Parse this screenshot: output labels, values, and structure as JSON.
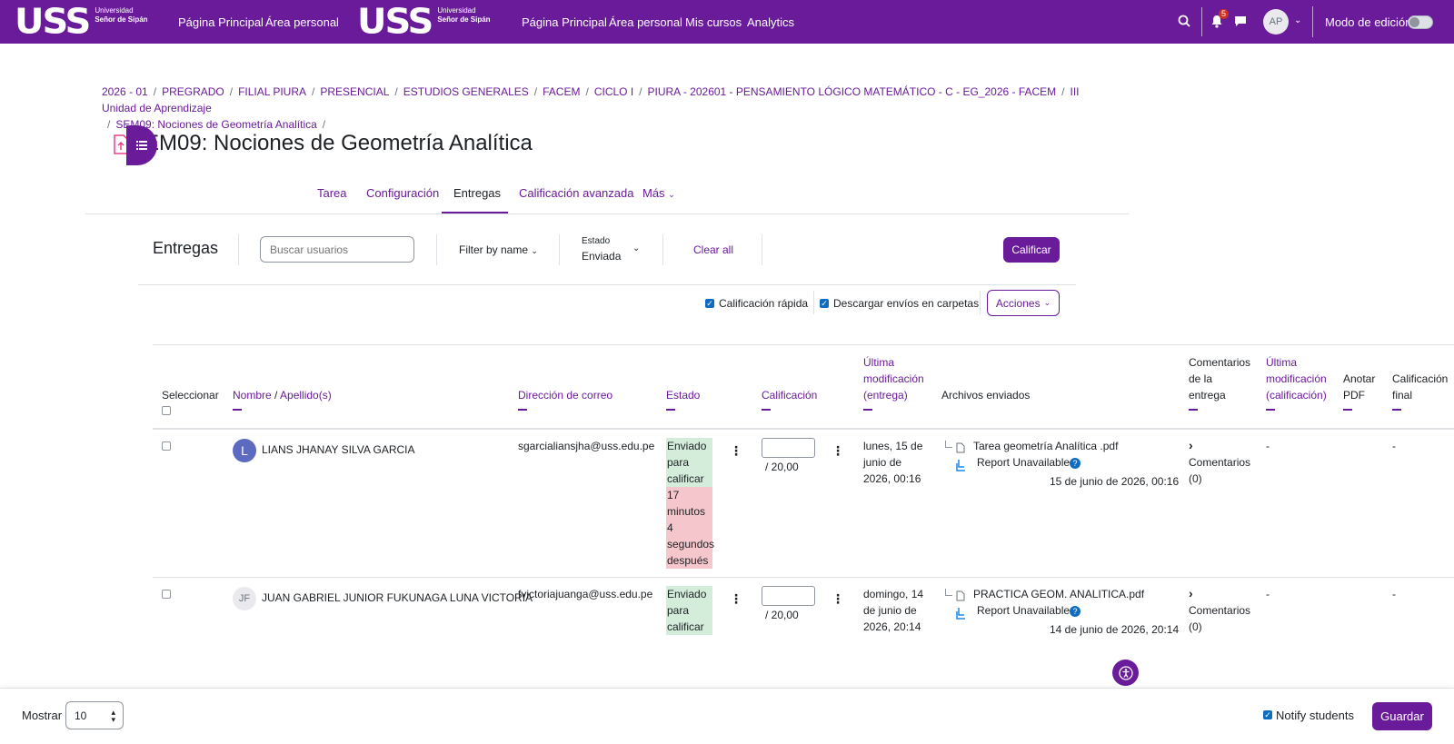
{
  "navbar": {
    "logo_text": "USS",
    "logo_sub1": "Universidad",
    "logo_sub2": "Señor de Sipán",
    "links_left": [
      "Página Principal",
      "Área personal"
    ],
    "links_right": [
      "Página Principal",
      "Área personal",
      "Mis cursos",
      "Analytics"
    ],
    "notifications_count": "5",
    "avatar_initials": "AP",
    "edit_mode_label": "Modo de edición"
  },
  "breadcrumb": [
    "2026 - 01",
    "PREGRADO",
    "FILIAL PIURA",
    "PRESENCIAL",
    "ESTUDIOS GENERALES",
    "FACEM",
    "CICLO I",
    "PIURA - 202601 - PENSAMIENTO LÓGICO MATEMÁTICO - C - EG_2026 - FACEM",
    "III Unidad de Aprendizaje",
    "SEM09: Nociones de Geometría Analítica"
  ],
  "page_title": "SEM09: Nociones de Geometría Analítica",
  "tabs": [
    "Tarea",
    "Configuración",
    "Entregas",
    "Calificación avanzada",
    "Más"
  ],
  "filters": {
    "heading": "Entregas",
    "search_placeholder": "Buscar usuarios",
    "filter_by_name": "Filter by name",
    "estado_label": "Estado",
    "estado_value": "Enviada",
    "clear_all": "Clear all",
    "grade_button": "Calificar"
  },
  "options": {
    "quick_grading": "Calificación rápida",
    "download_folders": "Descargar envíos en carpetas",
    "actions": "Acciones"
  },
  "table": {
    "headers": {
      "select": "Seleccionar",
      "name": "Nombre",
      "name_sep": " / ",
      "surname": "Apellido(s)",
      "email": "Dirección de correo",
      "status": "Estado",
      "grade": "Calificación",
      "last_mod_1": "Última",
      "last_mod_2": "modificación",
      "last_mod_3": "(entrega)",
      "files": "Archivos enviados",
      "comments_1": "Comentarios",
      "comments_2": "de la",
      "comments_3": "entrega",
      "last_grade_1": "Última",
      "last_grade_2": "modificación",
      "last_grade_3": "(calificación)",
      "annotate_1": "Anotar",
      "annotate_2": "PDF",
      "final_1": "Calificación",
      "final_2": "final"
    },
    "rows": [
      {
        "initials": "L",
        "name": "LIANS JHANAY SILVA GARCIA",
        "email": "sgarcialiansjha@uss.edu.pe",
        "status_lines": [
          "Enviado",
          "para",
          "calificar"
        ],
        "late_lines": [
          "17",
          "minutos",
          "4",
          "segundos",
          "después"
        ],
        "grade_max": "/ 20,00",
        "modified_lines": [
          "lunes, 15 de",
          "junio de",
          "2026, 00:16"
        ],
        "file": "Tarea geometría Analítica .pdf",
        "report": "Report Unavailable",
        "file_date": "15 de junio de 2026, 00:16",
        "comments_1": "Comentarios",
        "comments_2": "(0)",
        "last_grade": "-",
        "final": "-"
      },
      {
        "initials": "JF",
        "name": "JUAN GABRIEL JUNIOR FUKUNAGA LUNA VICTORIA",
        "email": "fvictoriajuanga@uss.edu.pe",
        "status_lines": [
          "Enviado",
          "para",
          "calificar"
        ],
        "grade_max": "/ 20,00",
        "modified_lines": [
          "domingo, 14",
          "de junio de",
          "2026, 20:14"
        ],
        "file": "PRACTICA GEOM. ANALITICA.pdf",
        "report": "Report Unavailable",
        "file_date": "14 de junio de 2026, 20:14",
        "comments_1": "Comentarios",
        "comments_2": "(0)",
        "last_grade": "-",
        "final": "-"
      }
    ]
  },
  "footer": {
    "show_label": "Mostrar",
    "per_page": "10",
    "notify_label": "Notify students",
    "save_button": "Guardar"
  },
  "colors": {
    "brand": "#6a1b9a",
    "submitted": "#d4edda",
    "late": "#f5c6cb"
  }
}
